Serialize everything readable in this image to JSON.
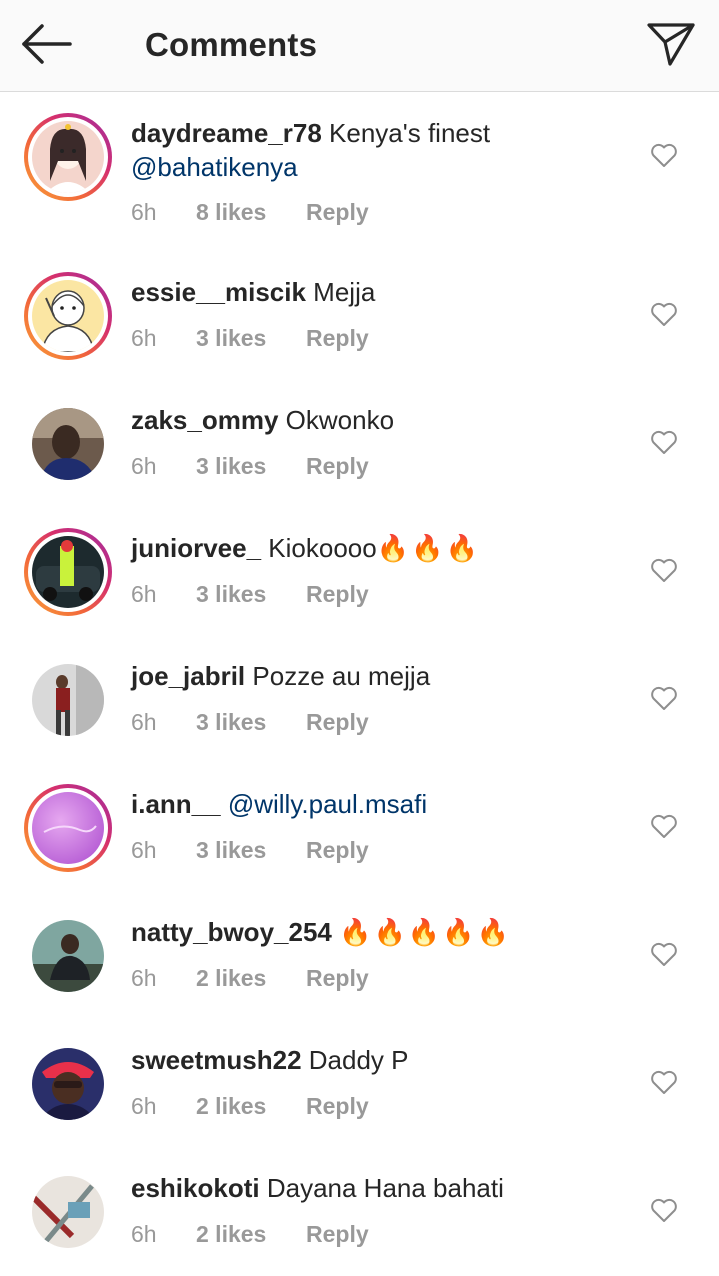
{
  "header": {
    "title": "Comments",
    "back_icon": "arrow-left-icon",
    "send_icon": "paper-plane-icon"
  },
  "colors": {
    "mention": "#003569",
    "meta": "#999999",
    "ring_gradient": [
      "#f9a23a",
      "#d52f6e",
      "#9c2ea5"
    ]
  },
  "comments": [
    {
      "username": "daydreame_r78",
      "text": "Kenya's finest",
      "mention": "@bahatikenya",
      "time": "6h",
      "likes": "8 likes",
      "reply": "Reply",
      "story_ring": true
    },
    {
      "username": "essie__miscik",
      "text": "Mejja",
      "mention": "",
      "time": "6h",
      "likes": "3 likes",
      "reply": "Reply",
      "story_ring": true
    },
    {
      "username": "zaks_ommy",
      "text": "Okwonko",
      "mention": "",
      "time": "6h",
      "likes": "3 likes",
      "reply": "Reply",
      "story_ring": false
    },
    {
      "username": "juniorvee_",
      "text": "Kiokoooo",
      "emoji": "🔥🔥🔥",
      "mention": "",
      "time": "6h",
      "likes": "3 likes",
      "reply": "Reply",
      "story_ring": true
    },
    {
      "username": "joe_jabril",
      "text": "Pozze au mejja",
      "mention": "",
      "time": "6h",
      "likes": "3 likes",
      "reply": "Reply",
      "story_ring": false
    },
    {
      "username": "i.ann__",
      "text": "",
      "mention": "@willy.paul.msafi",
      "time": "6h",
      "likes": "3 likes",
      "reply": "Reply",
      "story_ring": true
    },
    {
      "username": "natty_bwoy_254",
      "text": "",
      "emoji": "🔥🔥🔥🔥🔥",
      "mention": "",
      "time": "6h",
      "likes": "2 likes",
      "reply": "Reply",
      "story_ring": false
    },
    {
      "username": "sweetmush22",
      "text": "Daddy P",
      "mention": "",
      "time": "6h",
      "likes": "2 likes",
      "reply": "Reply",
      "story_ring": false
    },
    {
      "username": "eshikokoti",
      "text": "Dayana Hana bahati",
      "mention": "",
      "time": "6h",
      "likes": "2 likes",
      "reply": "Reply",
      "story_ring": false
    }
  ]
}
